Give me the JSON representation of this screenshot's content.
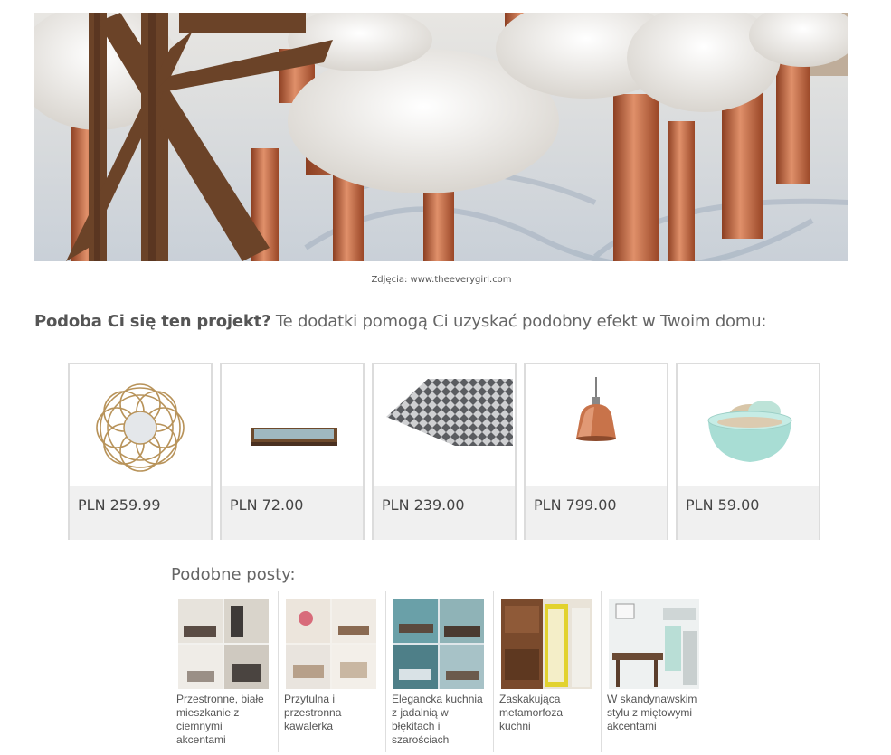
{
  "hero": {
    "image_description_icon": "dining-chairs-photo"
  },
  "caption": "Zdjęcia: www.theeverygirl.com",
  "intro": {
    "bold": "Podoba Ci się ten projekt?",
    "rest": " Te dodatki pomogą Ci uzyskać podobny efekt w Twoim domu:"
  },
  "products": [
    {
      "icon": "rattan-mirror-icon",
      "price": "PLN 259.99"
    },
    {
      "icon": "wooden-tray-icon",
      "price": "PLN 72.00"
    },
    {
      "icon": "patterned-rug-icon",
      "price": "PLN 239.00"
    },
    {
      "icon": "copper-pendant-lamp-icon",
      "price": "PLN 799.00"
    },
    {
      "icon": "mint-bowls-icon",
      "price": "PLN 59.00"
    }
  ],
  "similar": {
    "title": "Podobne posty:",
    "posts": [
      {
        "title": "Przestronne, białe mieszkanie z ciemnymi akcentami"
      },
      {
        "title": "Przytulna i przestronna kawalerka"
      },
      {
        "title": "Elegancka kuchnia z jadalnią w błękitach i szarościach"
      },
      {
        "title": "Zaskakująca metamorfoza kuchni"
      },
      {
        "title": "W skandynawskim stylu z miętowymi akcentami"
      }
    ]
  },
  "colors": {
    "copper": "#c8734a",
    "wood": "#6b4328",
    "fur": "#f4f2ee",
    "price_band": "#f0f0f0"
  }
}
